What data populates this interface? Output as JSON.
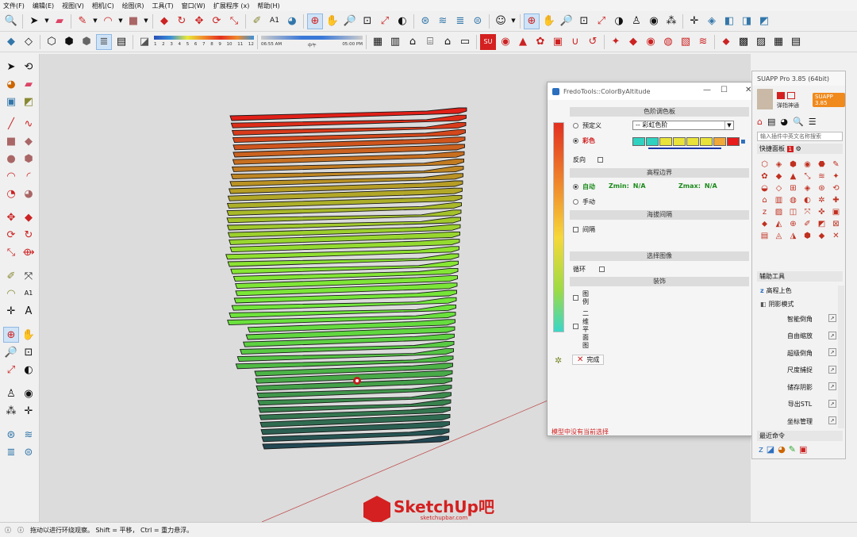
{
  "menu": [
    "文件(F)",
    "编辑(E)",
    "视图(V)",
    "相机(C)",
    "绘图(R)",
    "工具(T)",
    "窗口(W)",
    "扩展程序 (x)",
    "帮助(H)"
  ],
  "shadow_slider": {
    "months": [
      "1",
      "2",
      "3",
      "4",
      "5",
      "6",
      "7",
      "8",
      "9",
      "10",
      "11",
      "12"
    ],
    "time_start": "06:55 AM",
    "time_mid": "中午",
    "time_end": "05:00 PM"
  },
  "dialog": {
    "title": "FredoTools::ColorByAltitude",
    "section_palette": "色阶调色板",
    "opt_predefined": "预定义",
    "select_value": "-- 彩虹色阶",
    "opt_color": "彩色",
    "swatch_colors": [
      "#2fd2c0",
      "#2fd2c0",
      "#e8e23a",
      "#e8e23a",
      "#e8e23a",
      "#e8e23a",
      "#f0a83a",
      "#e81c1c"
    ],
    "reverse_label": "反向",
    "section_bounds": "高程边界",
    "opt_auto": "自动",
    "zmin_label": "Zmin:",
    "zmin_value": "N/A",
    "zmax_label": "Zmax:",
    "zmax_value": "N/A",
    "opt_manual": "手动",
    "section_interval": "海拔间隔",
    "interval_label": "间隔",
    "section_selection": "选择图像",
    "loop_label": "循环",
    "section_decor": "装饰",
    "legend_label": "图例",
    "plan_label": "二维平面图",
    "done_label": "完成",
    "status": "模型中没有当前选择"
  },
  "suapp": {
    "title": "SUAPP Pro 3.85 (64bit)",
    "badge": "SUAPP 3.85",
    "user_name": "弹指神通",
    "search_placeholder": "输入插件中英文名称搜索",
    "quick_panel": "快捷面板",
    "quick_panel_count": "1",
    "aux_tools": "辅助工具",
    "aux_items": [
      "高程上色",
      "阴影模式"
    ],
    "commands": [
      "智能倒角",
      "自由缩放",
      "超级倒角",
      "尺度捕捉",
      "储存阴影",
      "导出STL",
      "坐标管理"
    ],
    "recent": "最近命令"
  },
  "status_text": "拖动以进行环绕观察。 Shift = 平移， Ctrl = 重力悬浮。",
  "watermark": {
    "brand": "SketchUp吧",
    "url": "sketchupbar.com"
  }
}
